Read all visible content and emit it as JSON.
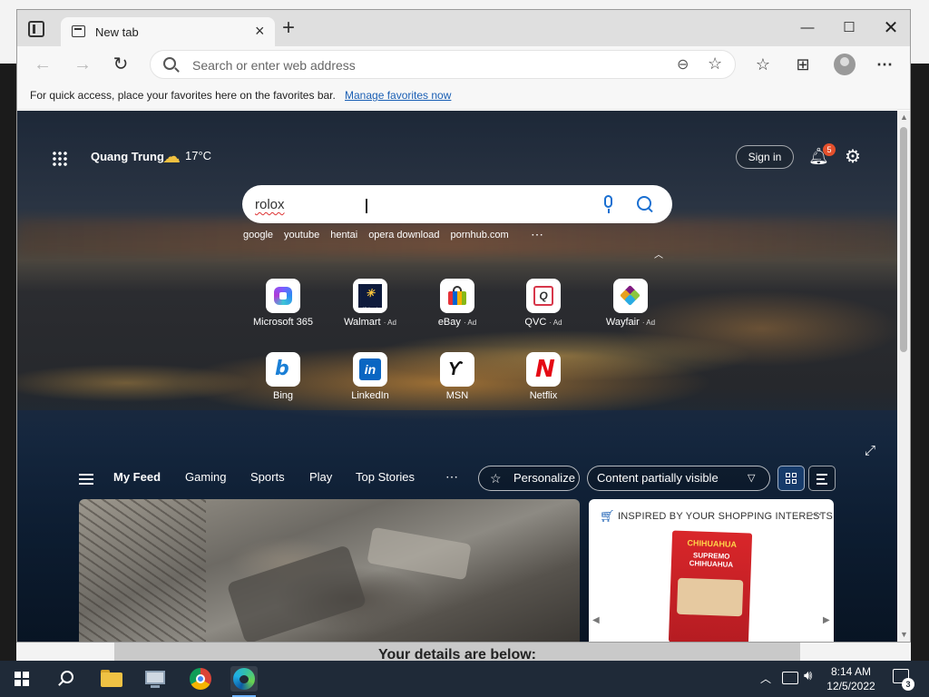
{
  "browser": {
    "tab_title": "New tab",
    "tab_close": "×",
    "new_tab": "+",
    "window_controls": {
      "minimize": "—",
      "maximize": "☐",
      "close": "✕"
    },
    "nav": {
      "back": "←",
      "forward": "→",
      "refresh": "↻"
    },
    "address_placeholder": "Search or enter web address",
    "toolbar_icons": [
      "zoom-out-icon",
      "add-favorite-icon",
      "favorites-icon",
      "collections-icon",
      "profile-icon",
      "more-icon"
    ],
    "favbar": {
      "text": "For quick access, place your favorites here on the favorites bar.",
      "link": "Manage favorites now"
    }
  },
  "newtab": {
    "location": "Quang Trung",
    "weather_icon": "cloud-moon-icon",
    "temperature": "17°C",
    "signin_label": "Sign in",
    "notification_count": "5",
    "search_value": "rolox",
    "trending": [
      "google",
      "youtube",
      "hentai",
      "opera download",
      "pornhub.com"
    ],
    "more_glyph": "⋯",
    "quick_links": [
      {
        "label": "Microsoft 365",
        "ad": ""
      },
      {
        "label": "Walmart",
        "ad": "· Ad"
      },
      {
        "label": "eBay",
        "ad": "· Ad"
      },
      {
        "label": "QVC",
        "ad": "· Ad"
      },
      {
        "label": "Wayfair",
        "ad": "· Ad"
      },
      {
        "label": "Bing",
        "ad": ""
      },
      {
        "label": "LinkedIn",
        "ad": ""
      },
      {
        "label": "MSN",
        "ad": ""
      },
      {
        "label": "Netflix",
        "ad": ""
      }
    ],
    "quick_link_glyphs": {
      "walmart": "✳",
      "walmart_text": "Walmart",
      "bing": "b",
      "linkedin": "in",
      "msn": "ϒ",
      "netflix": "N"
    },
    "feed_tabs": [
      "My Feed",
      "Gaming",
      "Sports",
      "Play",
      "Top Stories"
    ],
    "personalize_label": "Personalize",
    "content_visibility": "Content partially visible",
    "shopping_card": {
      "title": "INSPIRED BY YOUR SHOPPING INTERESTS",
      "product_brand": "CHIHUAHUA",
      "product_name": "SUPREMO",
      "product_sub": "CHIHUAHUA"
    }
  },
  "background_page": {
    "heading": "Your details are below:"
  },
  "taskbar": {
    "time": "8:14 AM",
    "date": "12/5/2022",
    "notification_count": "3",
    "apps": [
      "file-explorer-icon",
      "remote-desktop-icon",
      "chrome-icon",
      "edge-icon"
    ]
  }
}
